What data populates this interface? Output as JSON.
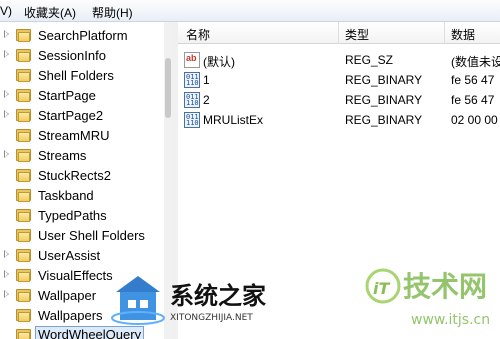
{
  "menubar": {
    "items": [
      {
        "label": "V)"
      },
      {
        "label": "收藏夹(A)"
      },
      {
        "label": "帮助(H)"
      }
    ]
  },
  "tree": {
    "items": [
      {
        "label": "SearchPlatform"
      },
      {
        "label": "SessionInfo"
      },
      {
        "label": "Shell Folders"
      },
      {
        "label": "StartPage"
      },
      {
        "label": "StartPage2"
      },
      {
        "label": "StreamMRU"
      },
      {
        "label": "Streams"
      },
      {
        "label": "StuckRects2"
      },
      {
        "label": "Taskband"
      },
      {
        "label": "TypedPaths"
      },
      {
        "label": "User Shell Folders"
      },
      {
        "label": "UserAssist"
      },
      {
        "label": "VisualEffects"
      },
      {
        "label": "Wallpaper"
      },
      {
        "label": "Wallpapers"
      },
      {
        "label": "WordWheelQuery"
      }
    ]
  },
  "list": {
    "columns": {
      "name": "名称",
      "type": "类型",
      "data": "数据"
    },
    "rows": [
      {
        "name": "(默认)",
        "type": "REG_SZ",
        "data": "(数值未设",
        "icon": "string-value-icon"
      },
      {
        "name": "1",
        "type": "REG_BINARY",
        "data": "fe 56 47",
        "icon": "binary-value-icon"
      },
      {
        "name": "2",
        "type": "REG_BINARY",
        "data": "fe 56 47",
        "icon": "binary-value-icon"
      },
      {
        "name": "MRUListEx",
        "type": "REG_BINARY",
        "data": "02 00 00",
        "icon": "binary-value-icon"
      }
    ]
  },
  "watermarks": {
    "left_title": "系统之家",
    "left_sub": "XITONGZHIJIA.NET",
    "right_title": "技术网",
    "right_url": "www.itjs.cn"
  }
}
